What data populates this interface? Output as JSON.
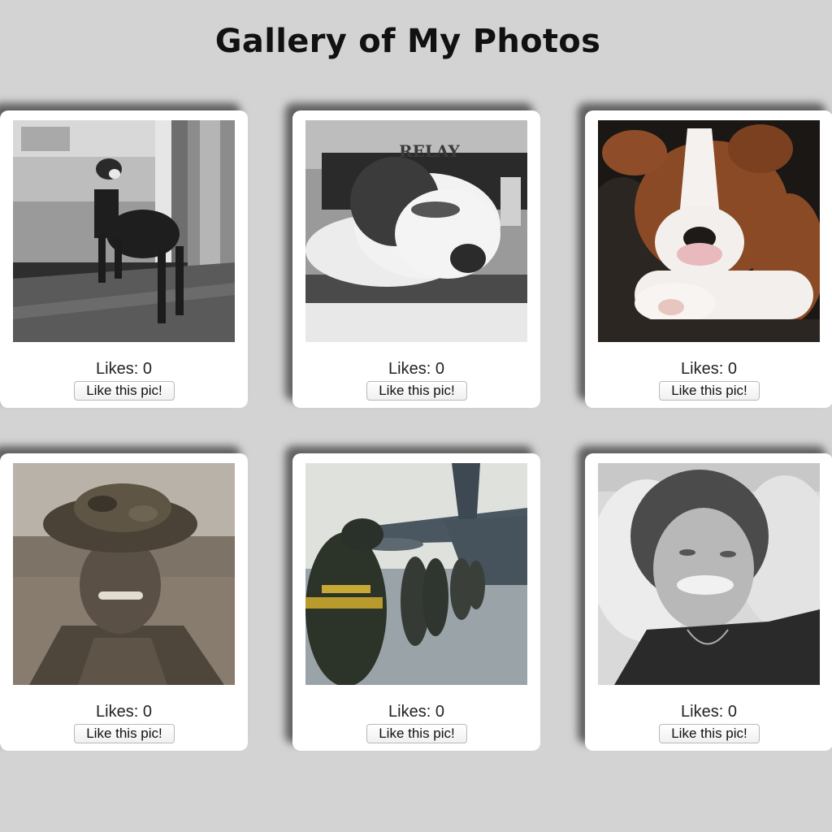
{
  "page": {
    "title": "Gallery of My Photos",
    "background": "#d3d3d3"
  },
  "photos": [
    {
      "likes_text": "Likes: 0",
      "likes": 0,
      "button_label": "Like this pic!"
    },
    {
      "likes_text": "Likes: 0",
      "likes": 0,
      "button_label": "Like this pic!",
      "photo_text": "RELAY"
    },
    {
      "likes_text": "Likes: 0",
      "likes": 0,
      "button_label": "Like this pic!"
    },
    {
      "likes_text": "Likes: 0",
      "likes": 0,
      "button_label": "Like this pic!"
    },
    {
      "likes_text": "Likes: 0",
      "likes": 0,
      "button_label": "Like this pic!"
    },
    {
      "likes_text": "Likes: 0",
      "likes": 0,
      "button_label": "Like this pic!"
    }
  ]
}
